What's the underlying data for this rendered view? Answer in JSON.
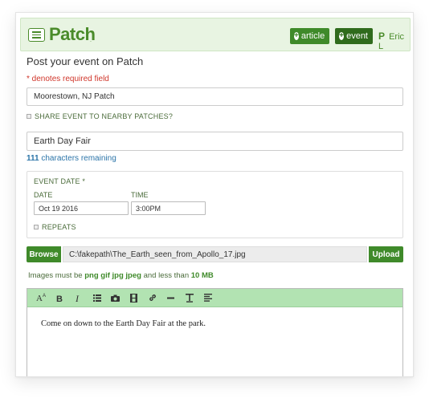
{
  "header": {
    "logo": "Patch",
    "logo_mark": ".",
    "article_button": "article",
    "event_button": "event",
    "user_initial": "P",
    "user_name": "Eric L"
  },
  "form": {
    "title": "Post your event on Patch",
    "required_note": "* denotes required field",
    "patch_value": "Moorestown, NJ Patch",
    "share_label": "SHARE EVENT TO NEARBY PATCHES?",
    "event_title_value": "Earth Day Fair",
    "chars_remaining_count": "111",
    "chars_remaining_text": "characters remaining",
    "event_date_label": "EVENT DATE *",
    "date_label": "DATE",
    "time_label": "TIME",
    "date_value": "Oct 19 2016",
    "time_value": "3:00PM",
    "repeats_label": "REPEATS",
    "browse_label": "Browse",
    "file_path": "C:\\fakepath\\The_Earth_seen_from_Apollo_17.jpg",
    "upload_label": "Upload",
    "image_note_prefix": "Images must be",
    "image_formats": "png gif jpg jpeg",
    "image_note_mid": "and less than",
    "image_max_size": "10 MB"
  },
  "editor": {
    "toolbar": [
      "font-size-icon",
      "bold-icon",
      "italic-icon",
      "list-icon",
      "camera-icon",
      "film-icon",
      "link-icon",
      "horizontal-rule-icon",
      "clear-format-icon",
      "align-left-icon"
    ],
    "body_text": "Come on down to the Earth Day Fair at the park."
  },
  "colors": {
    "brand_green": "#3f8a2a",
    "toolbar_green": "#b2e3b2",
    "required_red": "#d0362b",
    "link_blue": "#2b74a8"
  }
}
